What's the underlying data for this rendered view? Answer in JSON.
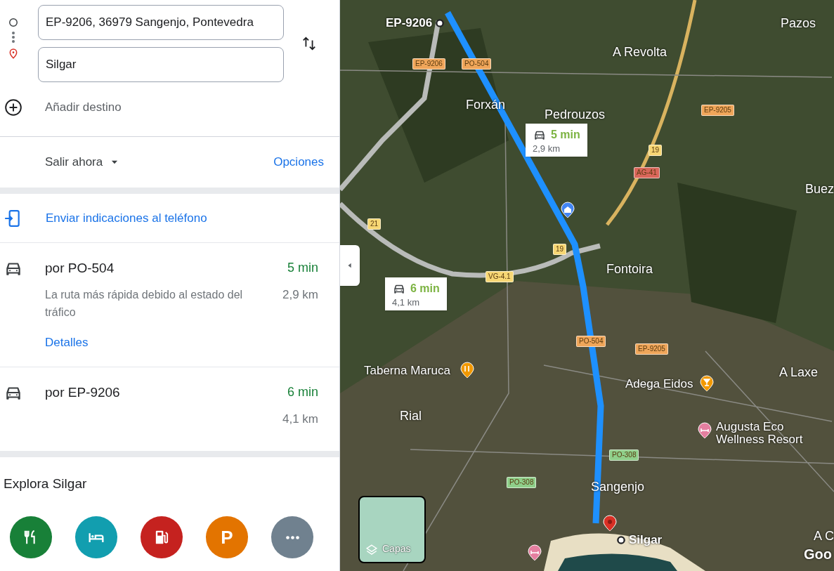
{
  "directions": {
    "origin": "EP-9206, 36979 Sangenjo, Pontevedra",
    "destination": "Silgar",
    "add_destination": "Añadir destino"
  },
  "depart": {
    "label": "Salir ahora",
    "options": "Opciones"
  },
  "send_to_phone": "Enviar indicaciones al teléfono",
  "routes": [
    {
      "title": "por PO-504",
      "time": "5 min",
      "distance": "2,9 km",
      "description": "La ruta más rápida debido al estado del tráfico",
      "details": "Detalles"
    },
    {
      "title": "por EP-9206",
      "time": "6 min",
      "distance": "4,1 km"
    }
  ],
  "explore": {
    "title": "Explora Silgar",
    "categories": [
      {
        "kind": "restaurant",
        "color": "#188038"
      },
      {
        "kind": "hotel",
        "color": "#129eaf"
      },
      {
        "kind": "gas",
        "color": "#c5221f"
      },
      {
        "kind": "parking",
        "color": "#e37400",
        "glyph": "P"
      },
      {
        "kind": "more",
        "color": "#70818f"
      }
    ]
  },
  "map": {
    "places": [
      {
        "label": "EP-9206",
        "kind": "origin"
      },
      {
        "label": "Pazos",
        "kind": "town"
      },
      {
        "label": "A Revolta",
        "kind": "town"
      },
      {
        "label": "Forxán",
        "kind": "town"
      },
      {
        "label": "Pedrouzos",
        "kind": "town"
      },
      {
        "label": "Buez",
        "kind": "town"
      },
      {
        "label": "Fontoira",
        "kind": "town"
      },
      {
        "label": "Taberna Maruca",
        "kind": "poi"
      },
      {
        "label": "Rial",
        "kind": "town"
      },
      {
        "label": "Adega Eidos",
        "kind": "poi"
      },
      {
        "label": "A Laxe",
        "kind": "town"
      },
      {
        "label": "Augusta Eco Wellness Resort",
        "kind": "poi"
      },
      {
        "label": "Sangenjo",
        "kind": "town"
      },
      {
        "label": "Silgar",
        "kind": "destination"
      },
      {
        "label": "A C",
        "kind": "town"
      },
      {
        "label": "Goo",
        "kind": "logo"
      }
    ],
    "shields": [
      {
        "label": "EP-9206",
        "color": "#f0a65a"
      },
      {
        "label": "PO-504",
        "color": "#f0a65a"
      },
      {
        "label": "EP-9205",
        "color": "#f0a65a"
      },
      {
        "label": "19",
        "color": "#f7d774"
      },
      {
        "label": "AG-41",
        "color": "#d9665a"
      },
      {
        "label": "21",
        "color": "#f7d774"
      },
      {
        "label": "19",
        "color": "#f7d774"
      },
      {
        "label": "VG-4.1",
        "color": "#f7d774"
      },
      {
        "label": "PO-504",
        "color": "#f0a65a"
      },
      {
        "label": "EP-9205",
        "color": "#f0a65a"
      },
      {
        "label": "PO-308",
        "color": "#8fcf8a"
      },
      {
        "label": "PO-308",
        "color": "#8fcf8a"
      }
    ],
    "callouts": [
      {
        "time": "5 min",
        "distance": "2,9 km"
      },
      {
        "time": "6 min",
        "distance": "4,1 km"
      }
    ],
    "layers": "Capas"
  }
}
